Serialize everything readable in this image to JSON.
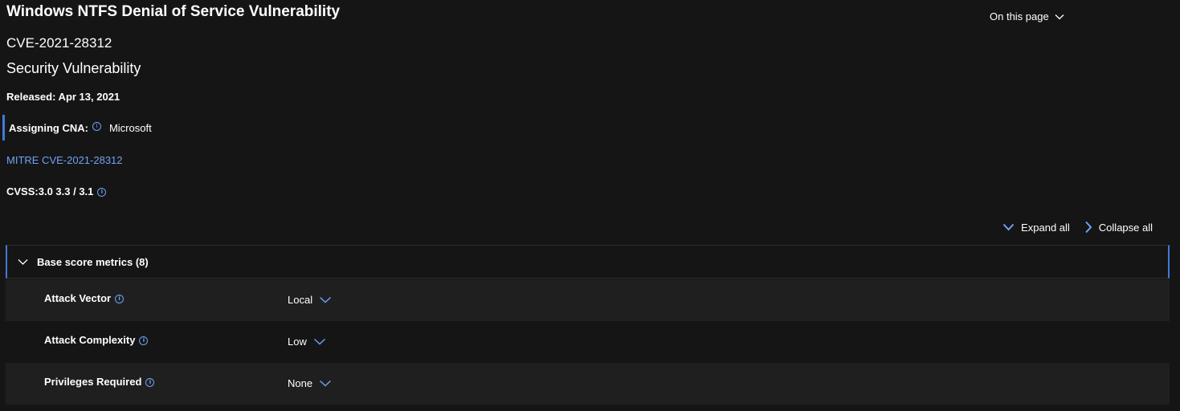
{
  "header": {
    "title": "Windows NTFS Denial of Service Vulnerability",
    "cve_id": "CVE-2021-28312",
    "subtitle": "Security Vulnerability",
    "released": "Released: Apr 13, 2021",
    "cna_label": "Assigning CNA:",
    "cna_value": "Microsoft",
    "mitre_link": "MITRE CVE-2021-28312",
    "cvss": "CVSS:3.0 3.3 / 3.1"
  },
  "on_this_page": "On this page",
  "toolbar": {
    "expand_all": "Expand all",
    "collapse_all": "Collapse all"
  },
  "panel": {
    "label": "Base score metrics (8)"
  },
  "metrics": [
    {
      "name": "Attack Vector",
      "value": "Local"
    },
    {
      "name": "Attack Complexity",
      "value": "Low"
    },
    {
      "name": "Privileges Required",
      "value": "None"
    }
  ],
  "colors": {
    "background": "#161516",
    "accent": "#3f7bd9",
    "link": "#6ea2f5",
    "row_shade": "#201f20"
  },
  "icons": {
    "info": "info-icon",
    "chevron_down": "chevron-down-icon",
    "chevron_right": "chevron-right-icon"
  }
}
